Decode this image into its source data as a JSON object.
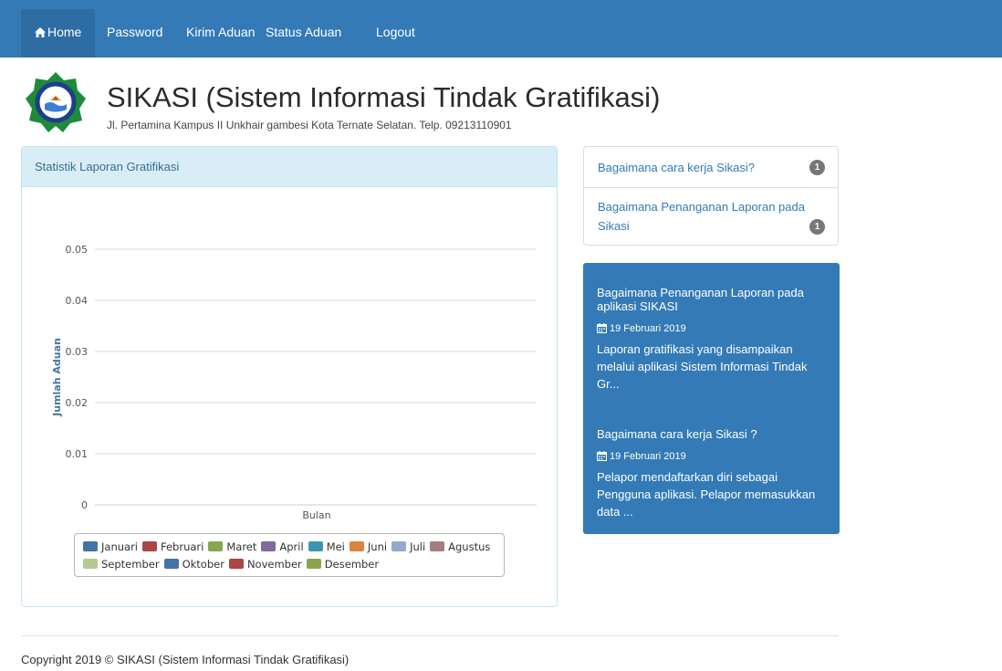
{
  "nav": {
    "items": [
      {
        "label": "Home",
        "icon": "home-icon",
        "active": true
      },
      {
        "label": "Password"
      },
      {
        "label": "Kirim Aduan"
      },
      {
        "label": "Status Aduan"
      },
      {
        "label": "Logout"
      }
    ]
  },
  "header": {
    "title": "SIKASI (Sistem Informasi Tindak Gratifikasi)",
    "address": "Jl. Pertamina Kampus II Unkhair gambesi Kota Ternate Selatan. Telp. 09213110901"
  },
  "chart_panel": {
    "heading": "Statistik Laporan Gratifikasi"
  },
  "chart_data": {
    "type": "bar",
    "title": "",
    "xlabel": "Bulan",
    "ylabel": "Jumlah Aduan",
    "yticks": [
      "0.05",
      "0.04",
      "0.03",
      "0.02",
      "0.01",
      "0"
    ],
    "ylim": [
      0,
      0.05
    ],
    "grid": true,
    "legend_position": "bottom",
    "categories": [
      "Bulan"
    ],
    "series": [
      {
        "name": "Januari",
        "values": [
          0
        ],
        "color": "#4572a7"
      },
      {
        "name": "Februari",
        "values": [
          0
        ],
        "color": "#aa4643"
      },
      {
        "name": "Maret",
        "values": [
          0
        ],
        "color": "#89a54e"
      },
      {
        "name": "April",
        "values": [
          0
        ],
        "color": "#80699b"
      },
      {
        "name": "Mei",
        "values": [
          0
        ],
        "color": "#3d96ae"
      },
      {
        "name": "Juni",
        "values": [
          0
        ],
        "color": "#db843d"
      },
      {
        "name": "Juli",
        "values": [
          0
        ],
        "color": "#92a8cd"
      },
      {
        "name": "Agustus",
        "values": [
          0
        ],
        "color": "#a47d7c"
      },
      {
        "name": "September",
        "values": [
          0
        ],
        "color": "#b5ca92"
      },
      {
        "name": "Oktober",
        "values": [
          0
        ],
        "color": "#4572a7"
      },
      {
        "name": "November",
        "values": [
          0
        ],
        "color": "#aa4643"
      },
      {
        "name": "Desember",
        "values": [
          0
        ],
        "color": "#89a54e"
      }
    ]
  },
  "faq": {
    "items": [
      {
        "label": "Bagaimana cara kerja Sikasi?",
        "badge": "1"
      },
      {
        "label": "Bagaimana Penanganan Laporan pada Sikasi",
        "badge": "1"
      }
    ]
  },
  "news": {
    "items": [
      {
        "title": "Bagaimana Penanganan Laporan pada aplikasi SIKASI",
        "date": "19 Februari 2019",
        "excerpt": "Laporan gratifikasi yang disampaikan melalui aplikasi Sistem Informasi Tindak Gr..."
      },
      {
        "title": "Bagaimana cara kerja Sikasi ?",
        "date": "19 Februari 2019",
        "excerpt": "Pelapor mendaftarkan diri sebagai Pengguna aplikasi. Pelapor memasukkan data ..."
      }
    ]
  },
  "footer": {
    "copyright": "Copyright 2019 © SIKASI (Sistem Informasi Tindak Gratifikasi)"
  },
  "colors": {
    "navbar": "#337ab7",
    "nav_active": "#2e6da4",
    "panel_heading": "#d9edf7",
    "panel_heading_text": "#31708f",
    "news_panel": "#337ab7",
    "badge": "#777777"
  }
}
